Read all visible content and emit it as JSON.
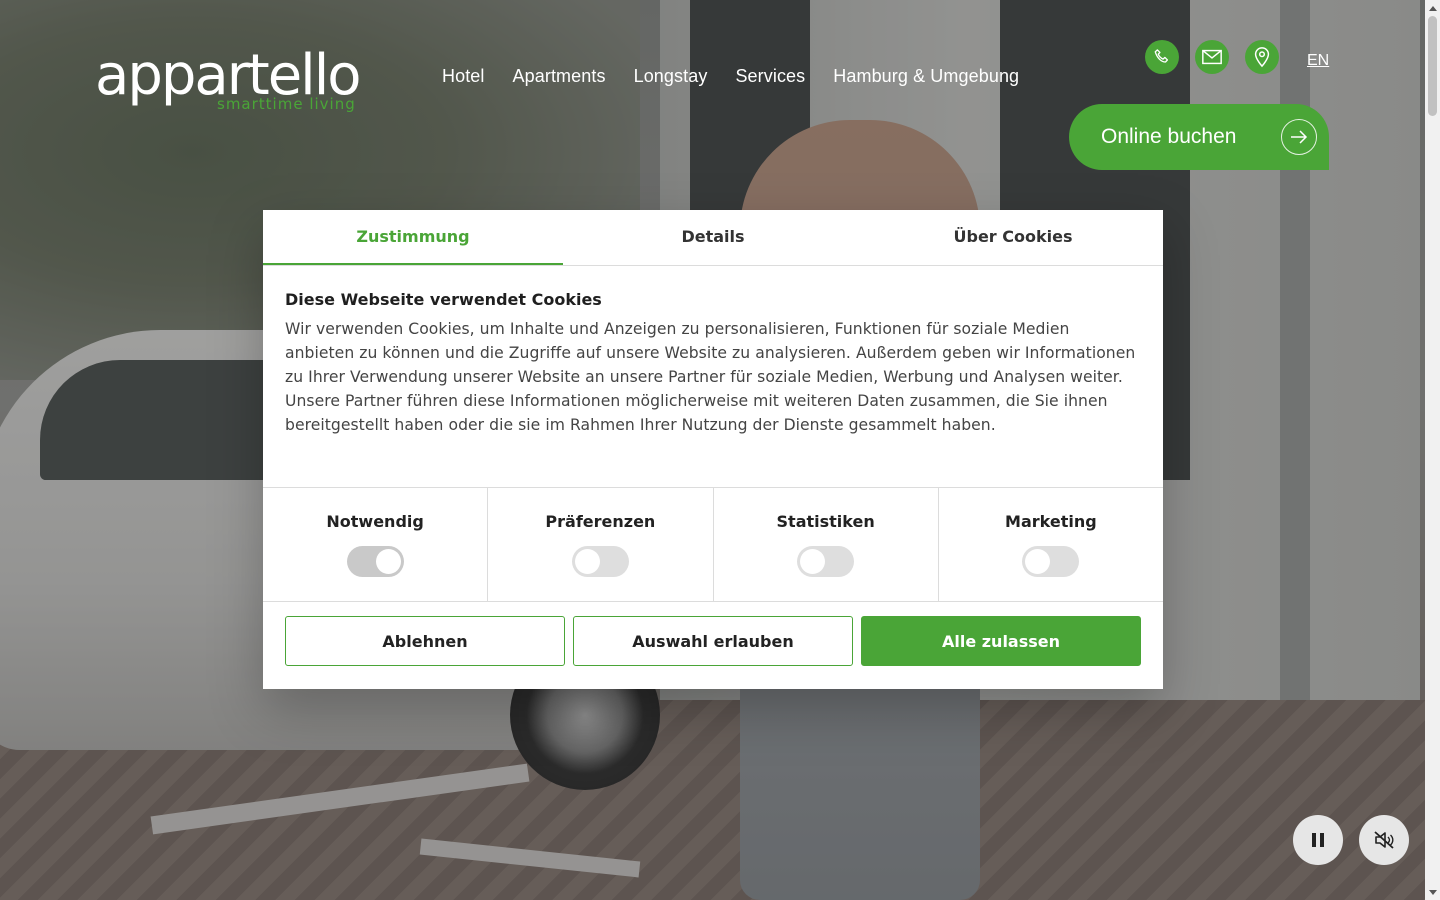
{
  "brand": {
    "name": "appartello",
    "tagline": "smarttime living",
    "accent": "#4aa537"
  },
  "nav": {
    "items": [
      "Hotel",
      "Apartments",
      "Longstay",
      "Services",
      "Hamburg & Umgebung"
    ]
  },
  "header": {
    "icons": [
      "phone-icon",
      "mail-icon",
      "location-icon"
    ],
    "language": "EN",
    "book_label": "Online buchen"
  },
  "cookie_dialog": {
    "tabs": [
      "Zustimmung",
      "Details",
      "Über Cookies"
    ],
    "active_tab": "Zustimmung",
    "heading": "Diese Webseite verwendet Cookies",
    "body": "Wir verwenden Cookies, um Inhalte und Anzeigen zu personalisieren, Funktionen für soziale Medien anbieten zu können und die Zugriffe auf unsere Website zu analysieren. Außerdem geben wir Informationen zu Ihrer Verwendung unserer Website an unsere Partner für soziale Medien, Werbung und Analysen weiter. Unsere Partner führen diese Informationen möglicherweise mit weiteren Daten zusammen, die Sie ihnen bereitgestellt haben oder die sie im Rahmen Ihrer Nutzung der Dienste gesammelt haben.",
    "categories": [
      {
        "label": "Notwendig",
        "enabled": true
      },
      {
        "label": "Präferenzen",
        "enabled": false
      },
      {
        "label": "Statistiken",
        "enabled": false
      },
      {
        "label": "Marketing",
        "enabled": false
      }
    ],
    "buttons": {
      "reject": "Ablehnen",
      "allow_selection": "Auswahl erlauben",
      "allow_all": "Alle zulassen"
    }
  },
  "media_controls": {
    "pause_icon": "pause-icon",
    "mute_icon": "muted-speaker-icon"
  }
}
